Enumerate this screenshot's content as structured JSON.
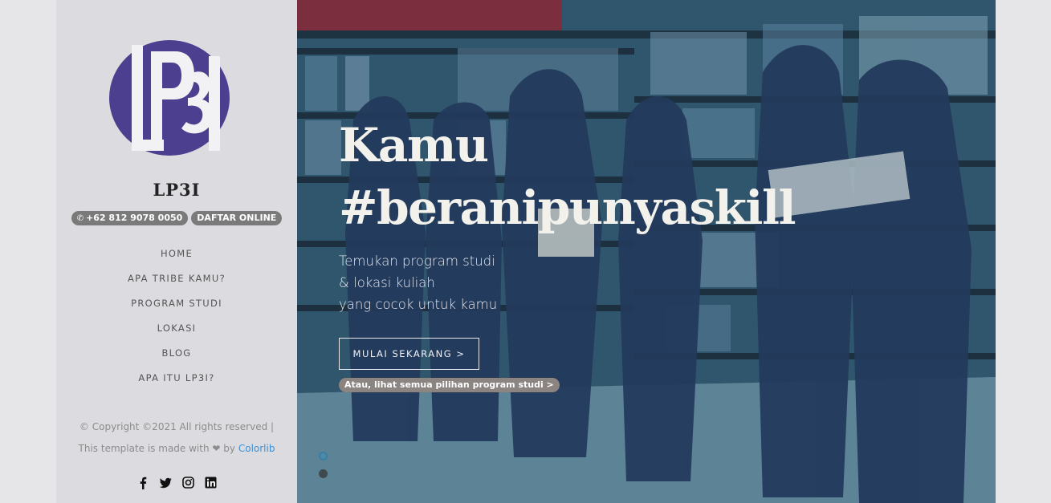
{
  "brand": "LP3I",
  "logo_text": "LP3I",
  "contact": {
    "phone": "+62 812 9078 0050",
    "daftar": "DAFTAR ONLINE"
  },
  "nav": [
    "HOME",
    "APA TRIBE KAMU?",
    "PROGRAM STUDI",
    "LOKASI",
    "BLOG",
    "APA ITU LP3I?"
  ],
  "footer": {
    "copyright": "© Copyright ©2021 All rights reserved |",
    "made_with": "This template is made with",
    "heart": "❤",
    "by": "by",
    "colorlib": "Colorlib"
  },
  "social": [
    "facebook-icon",
    "twitter-icon",
    "instagram-icon",
    "linkedin-icon"
  ],
  "hero": {
    "line1": "Kamu",
    "line2": "#beranipunyaskill",
    "sub1": "Temukan program studi",
    "sub2": "& lokasi kuliah",
    "sub3": "yang cocok untuk kamu",
    "cta": "MULAI SEKARANG >",
    "alt": "Atau, lihat semua pilihan program studi >"
  },
  "colors": {
    "logo_purple": "#4c3f8f",
    "link": "#3a8fd6",
    "sidebar": "#dcdce0"
  }
}
